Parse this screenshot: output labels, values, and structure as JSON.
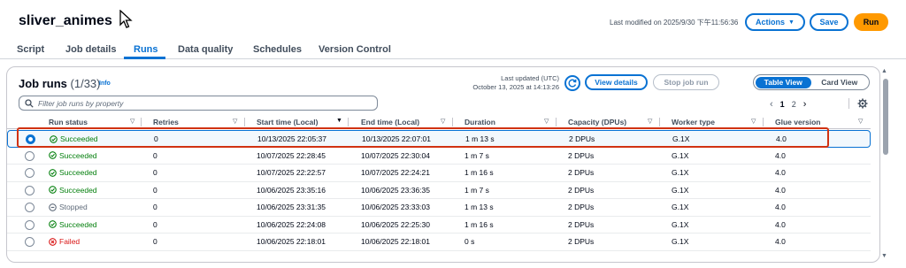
{
  "header": {
    "job_title": "sliver_animes",
    "last_modified": "Last modified on 2025/9/30 下午11:56:36",
    "actions_label": "Actions",
    "save_label": "Save",
    "run_label": "Run"
  },
  "tabs": [
    {
      "label": "Script"
    },
    {
      "label": "Job details"
    },
    {
      "label": "Runs"
    },
    {
      "label": "Data quality"
    },
    {
      "label": "Schedules"
    },
    {
      "label": "Version Control"
    }
  ],
  "active_tab": "Runs",
  "panel": {
    "title": "Job runs",
    "count": "(1/33)",
    "info": "Info",
    "last_updated_label": "Last updated (UTC)",
    "last_updated_value": "October 13, 2025 at 14:13:26",
    "view_details_label": "View details",
    "stop_job_label": "Stop job run",
    "view_toggle": [
      "Table View",
      "Card View"
    ],
    "active_view": "Table View"
  },
  "search": {
    "placeholder": "Filter job runs by property"
  },
  "pagination": {
    "pages": [
      "1",
      "2"
    ],
    "current": "1"
  },
  "columns": [
    "Run status",
    "Retries",
    "Start time (Local)",
    "End time (Local)",
    "Duration",
    "Capacity (DPUs)",
    "Worker type",
    "Glue version"
  ],
  "rows": [
    {
      "status": "Succeeded",
      "kind": "success",
      "retries": "0",
      "start": "10/13/2025 22:05:37",
      "end": "10/13/2025 22:07:01",
      "duration": "1 m 13 s",
      "capacity": "2 DPUs",
      "worker": "G.1X",
      "glue": "4.0",
      "selected": true
    },
    {
      "status": "Succeeded",
      "kind": "success",
      "retries": "0",
      "start": "10/07/2025 22:28:45",
      "end": "10/07/2025 22:30:04",
      "duration": "1 m 7 s",
      "capacity": "2 DPUs",
      "worker": "G.1X",
      "glue": "4.0",
      "selected": false
    },
    {
      "status": "Succeeded",
      "kind": "success",
      "retries": "0",
      "start": "10/07/2025 22:22:57",
      "end": "10/07/2025 22:24:21",
      "duration": "1 m 16 s",
      "capacity": "2 DPUs",
      "worker": "G.1X",
      "glue": "4.0",
      "selected": false
    },
    {
      "status": "Succeeded",
      "kind": "success",
      "retries": "0",
      "start": "10/06/2025 23:35:16",
      "end": "10/06/2025 23:36:35",
      "duration": "1 m 7 s",
      "capacity": "2 DPUs",
      "worker": "G.1X",
      "glue": "4.0",
      "selected": false
    },
    {
      "status": "Stopped",
      "kind": "stopped",
      "retries": "0",
      "start": "10/06/2025 23:31:35",
      "end": "10/06/2025 23:33:03",
      "duration": "1 m 13 s",
      "capacity": "2 DPUs",
      "worker": "G.1X",
      "glue": "4.0",
      "selected": false
    },
    {
      "status": "Succeeded",
      "kind": "success",
      "retries": "0",
      "start": "10/06/2025 22:24:08",
      "end": "10/06/2025 22:25:30",
      "duration": "1 m 16 s",
      "capacity": "2 DPUs",
      "worker": "G.1X",
      "glue": "4.0",
      "selected": false
    },
    {
      "status": "Failed",
      "kind": "failed",
      "retries": "0",
      "start": "10/06/2025 22:18:01",
      "end": "10/06/2025 22:18:01",
      "duration": "0 s",
      "capacity": "2 DPUs",
      "worker": "G.1X",
      "glue": "4.0",
      "selected": false
    }
  ],
  "colors": {
    "accent": "#0972d3",
    "run_button": "#ff9900",
    "success": "#037f0c",
    "failed": "#d91515",
    "highlight": "#d13212"
  }
}
